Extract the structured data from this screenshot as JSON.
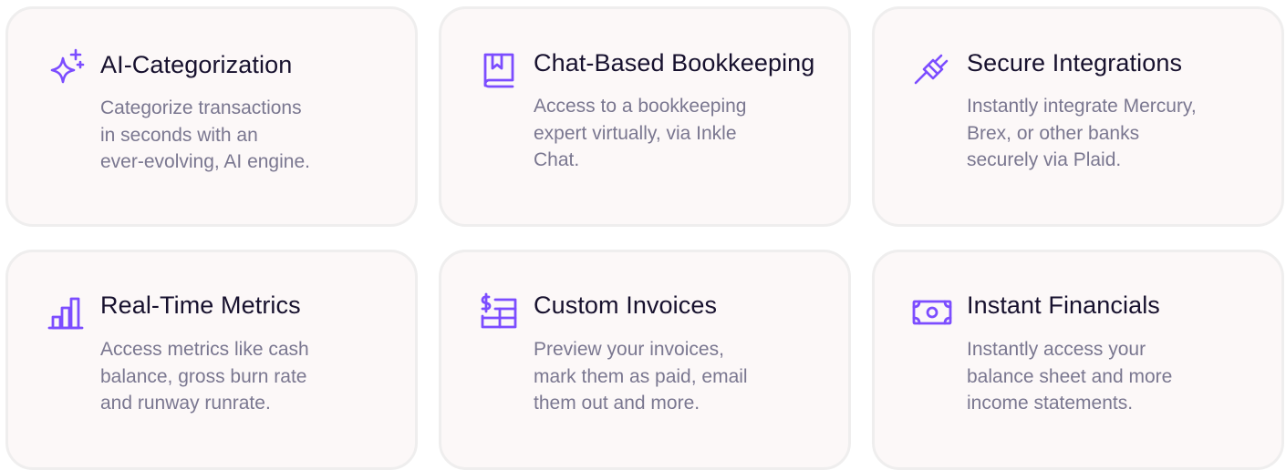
{
  "accent_color": "#7c4dff",
  "features": [
    {
      "icon": "sparkles-icon",
      "title": "AI-Categorization",
      "lines": [
        "Categorize transactions",
        "in seconds with an",
        "ever-evolving, AI engine."
      ]
    },
    {
      "icon": "book-bookmark-icon",
      "title": "Chat-Based Bookkeeping",
      "lines": [
        "Access to a bookkeeping",
        "expert virtually, via Inkle",
        "Chat."
      ]
    },
    {
      "icon": "plug-icon",
      "title": "Secure Integrations",
      "lines": [
        "Instantly integrate Mercury,",
        "Brex, or other banks",
        "securely via Plaid."
      ]
    },
    {
      "icon": "bar-chart-icon",
      "title": "Real-Time Metrics",
      "lines": [
        "Access metrics like cash",
        "balance, gross burn rate",
        "and runway runrate."
      ]
    },
    {
      "icon": "invoice-icon",
      "title": "Custom Invoices",
      "lines": [
        "Preview your invoices,",
        "mark them as paid, email",
        "them out and more."
      ]
    },
    {
      "icon": "banknote-icon",
      "title": "Instant Financials",
      "lines": [
        "Instantly access your",
        "balance sheet and more",
        "income statements."
      ]
    }
  ]
}
